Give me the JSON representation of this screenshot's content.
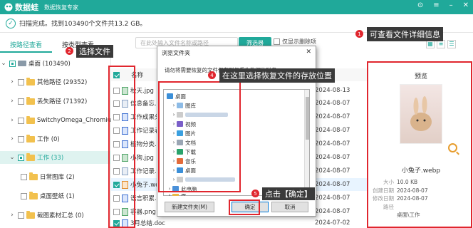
{
  "app": {
    "name": "数据蛙",
    "subtitle": "数据恢复专家"
  },
  "status": {
    "text": "扫描完成。找到103490个文件共13.2 GB。"
  },
  "tabs": [
    {
      "label": "按路径查看"
    },
    {
      "label": "按类型查看"
    }
  ],
  "search": {
    "placeholder": "在此处输入文件名称或路径"
  },
  "filter": {
    "label": "筛选器"
  },
  "only_deleted": {
    "label": "仅显示删除项"
  },
  "tree": [
    {
      "label": "桌面 (103490)"
    },
    {
      "label": "其他路径 (29352)"
    },
    {
      "label": "丢失路径 (71392)"
    },
    {
      "label": "SwitchyOmega_Chromiu"
    },
    {
      "label": "工作 (0)"
    },
    {
      "label": "工作 (33)"
    },
    {
      "label": "日常图库 (2)"
    },
    {
      "label": "桌面壁纸 (1)"
    },
    {
      "label": "截图素材汇总 (0)"
    }
  ],
  "list": {
    "header_name": "名称",
    "rows": [
      {
        "name": "秋天.jpg",
        "date": "2024-08-13"
      },
      {
        "name": "信息备忘.txt",
        "date": "2024-08-07"
      },
      {
        "name": "工作成果分析",
        "date": "2024-08-07"
      },
      {
        "name": "工作记录表",
        "date": "2024-08-07"
      },
      {
        "name": "植物分类.doc",
        "date": "2024-08-07"
      },
      {
        "name": "小狗.jpg",
        "date": "2024-08-07"
      },
      {
        "name": "工作记录.tx",
        "date": "2024-08-07"
      },
      {
        "name": "小兔子.webp",
        "date": "2024-08-07"
      },
      {
        "name": "语言积累.doc",
        "date": "2024-08-07"
      },
      {
        "name": "容器.png",
        "date": "2024-08-07"
      },
      {
        "name": "3月总结.doc",
        "date": "2024-07-02"
      }
    ]
  },
  "preview": {
    "title": "预览",
    "file_name": "小兔子.webp",
    "info": [
      {
        "key": "大小",
        "value": "10.0 KB"
      },
      {
        "key": "创建日期",
        "value": "2024-08-07"
      },
      {
        "key": "修改日期",
        "value": "2024-08-07"
      },
      {
        "key": "路径",
        "value": ""
      },
      {
        "key": "",
        "value": "桌面\\工作"
      }
    ]
  },
  "dialog": {
    "title": "浏览文件夹",
    "message": "请勿将需要恢复的文件保存到与丢失数据的磁盘...",
    "items": [
      {
        "label": "桌面"
      },
      {
        "label": "图库"
      },
      {
        "label": ""
      },
      {
        "label": "视频"
      },
      {
        "label": "图片"
      },
      {
        "label": "文档"
      },
      {
        "label": "下载"
      },
      {
        "label": "音乐"
      },
      {
        "label": "桌面"
      },
      {
        "label": ""
      },
      {
        "label": "此电脑"
      },
      {
        "label": "库"
      }
    ],
    "new_folder": "新建文件夹(M)",
    "ok": "确定",
    "cancel": "取消"
  },
  "annotations": [
    {
      "num": "1",
      "text": "可查看文件详细信息"
    },
    {
      "num": "2",
      "text": "选择文件"
    },
    {
      "num": "4",
      "text": "在这里选择恢复文件的存放位置"
    },
    {
      "num": "5",
      "text": "点击【确定】"
    }
  ],
  "colors": {
    "accent": "#20a99a",
    "annotation": "#e0262e"
  }
}
